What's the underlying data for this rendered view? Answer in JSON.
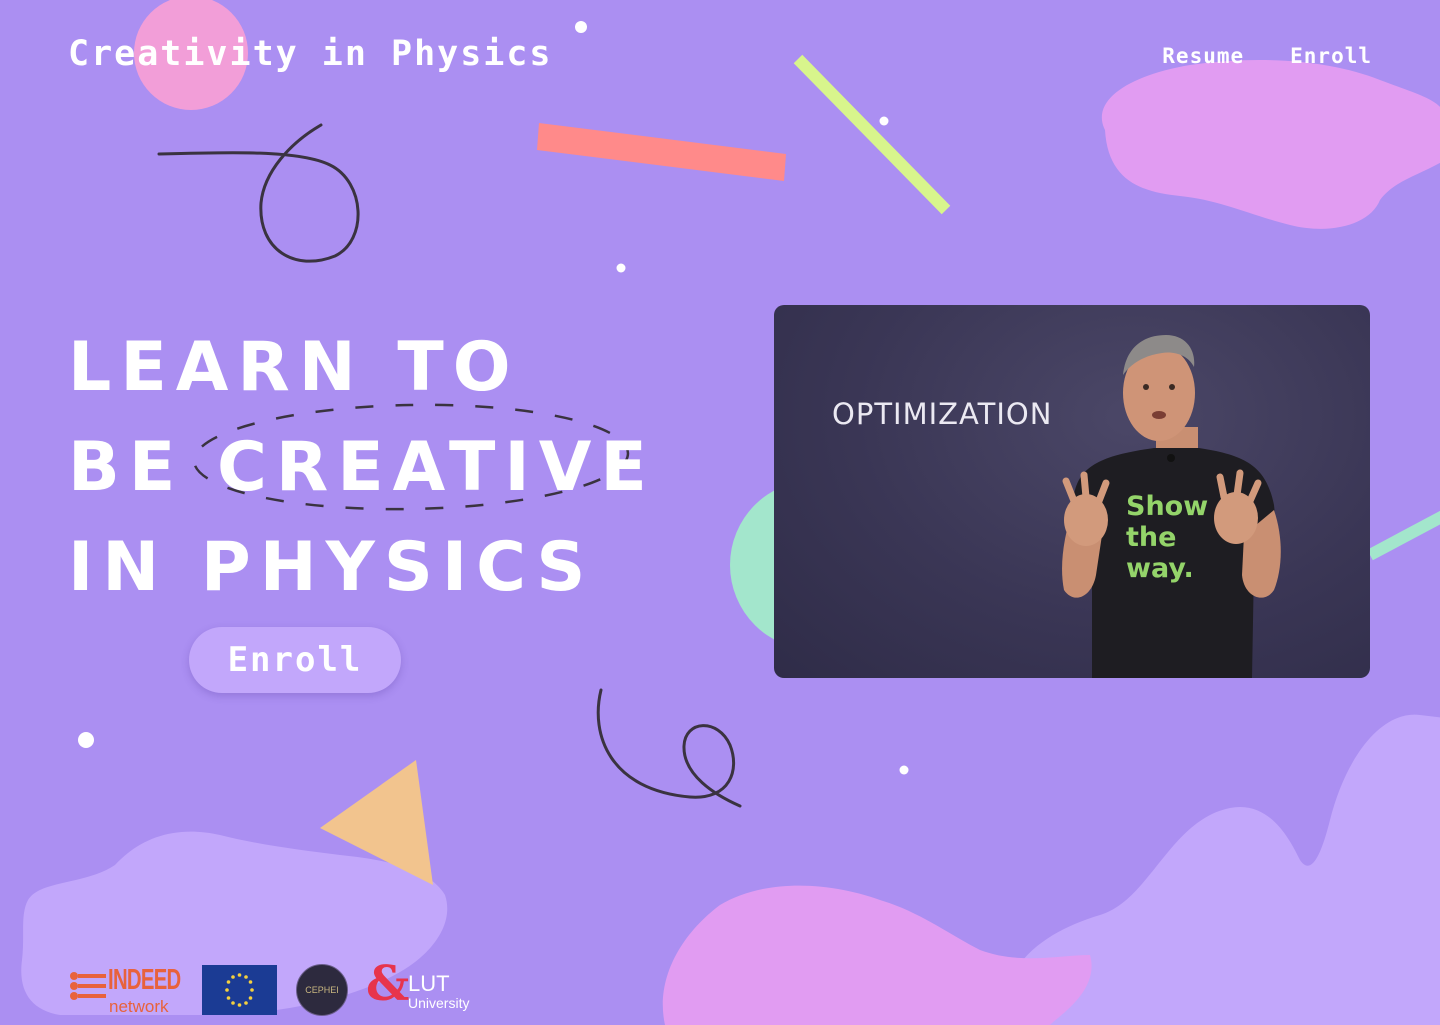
{
  "brand": {
    "title": "Creativity in Physics"
  },
  "nav": {
    "resume_label": "Resume",
    "enroll_label": "Enroll"
  },
  "hero": {
    "line1": "LEARN TO",
    "line2": "BE CREATIVE",
    "line3": "IN PHYSICS",
    "enroll_label": "Enroll"
  },
  "video": {
    "slide_title": "OPTIMIZATION",
    "shirt_line1": "Show",
    "shirt_line2": "the",
    "shirt_line3": "way."
  },
  "partners": {
    "indeed_top": "INDEED",
    "indeed_bottom": "network",
    "cephei": "CEPHEI",
    "lut_top": "LUT",
    "lut_bottom": "University"
  },
  "colors": {
    "background": "#ab8ff2",
    "pink_blob": "#e19cf2",
    "light_blob": "#c2a7fb",
    "coral": "#ff8a8a",
    "lime": "#d8f58c",
    "mint": "#a3e6cc",
    "orange": "#f2c48e"
  }
}
